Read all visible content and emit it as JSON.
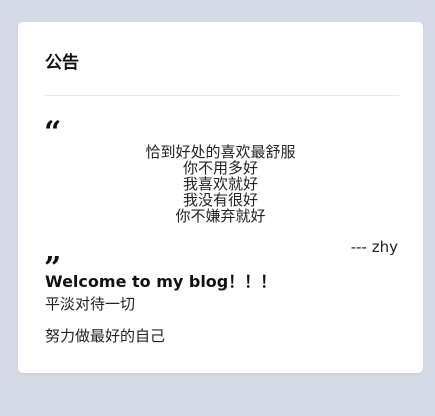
{
  "announcement": {
    "title": "公告",
    "quote": {
      "open_mark": "“",
      "close_mark": "”",
      "lines": [
        "恰到好处的喜欢最舒服",
        "你不用多好",
        "我喜欢就好",
        "我没有很好",
        "你不嫌弃就好"
      ],
      "author": "--- zhy"
    },
    "welcome": "Welcome to my blog！！！",
    "notes": [
      "平淡对待一切",
      "努力做最好的自己"
    ]
  }
}
